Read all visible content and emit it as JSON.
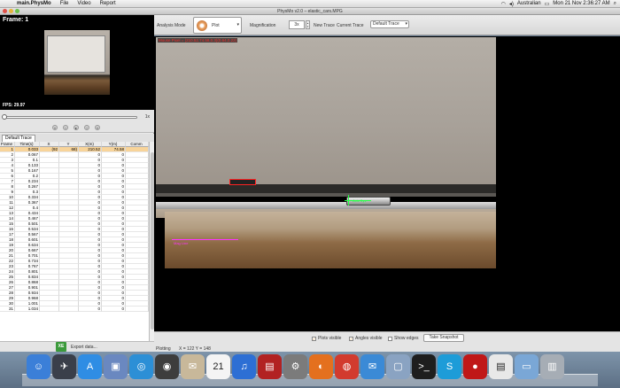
{
  "menubar": {
    "app": "main.PhysMo",
    "items": [
      "File",
      "Video",
      "Report"
    ],
    "status_icons": [
      "wifi",
      "volume",
      "battery"
    ],
    "language": "Australian",
    "clock": "Mon 21 Nov  2:36:27 AM"
  },
  "window": {
    "title": "PhysMo v2.0 – elastic_cars.MPG"
  },
  "preview": {
    "frame_label": "Frame: 1",
    "fps_label": "FPS: 29.97"
  },
  "playback": {
    "speed": "1x"
  },
  "trace_tab": "Default Trace",
  "table": {
    "columns": [
      "Frame",
      "Time(s)",
      "X",
      "Y",
      "X(m)",
      "Y(m)",
      "Comm"
    ],
    "rows": [
      [
        "1",
        "0.033",
        "(92",
        "68)",
        "210.52",
        "74.58",
        ""
      ],
      [
        "2",
        "0.067",
        "",
        "",
        "0",
        "0",
        ""
      ],
      [
        "3",
        "0.1",
        "",
        "",
        "0",
        "0",
        ""
      ],
      [
        "4",
        "0.133",
        "",
        "",
        "0",
        "0",
        ""
      ],
      [
        "5",
        "0.167",
        "",
        "",
        "0",
        "0",
        ""
      ],
      [
        "6",
        "0.2",
        "",
        "",
        "0",
        "0",
        ""
      ],
      [
        "7",
        "0.234",
        "",
        "",
        "0",
        "0",
        ""
      ],
      [
        "8",
        "0.267",
        "",
        "",
        "0",
        "0",
        ""
      ],
      [
        "9",
        "0.3",
        "",
        "",
        "0",
        "0",
        ""
      ],
      [
        "10",
        "0.334",
        "",
        "",
        "0",
        "0",
        ""
      ],
      [
        "11",
        "0.367",
        "",
        "",
        "0",
        "0",
        ""
      ],
      [
        "12",
        "0.4",
        "",
        "",
        "0",
        "0",
        ""
      ],
      [
        "13",
        "0.434",
        "",
        "",
        "0",
        "0",
        ""
      ],
      [
        "14",
        "0.467",
        "",
        "",
        "0",
        "0",
        ""
      ],
      [
        "15",
        "0.501",
        "",
        "",
        "0",
        "0",
        ""
      ],
      [
        "16",
        "0.534",
        "",
        "",
        "0",
        "0",
        ""
      ],
      [
        "17",
        "0.567",
        "",
        "",
        "0",
        "0",
        ""
      ],
      [
        "18",
        "0.601",
        "",
        "",
        "0",
        "0",
        ""
      ],
      [
        "19",
        "0.634",
        "",
        "",
        "0",
        "0",
        ""
      ],
      [
        "20",
        "0.667",
        "",
        "",
        "0",
        "0",
        ""
      ],
      [
        "21",
        "0.701",
        "",
        "",
        "0",
        "0",
        ""
      ],
      [
        "22",
        "0.734",
        "",
        "",
        "0",
        "0",
        ""
      ],
      [
        "23",
        "0.767",
        "",
        "",
        "0",
        "0",
        ""
      ],
      [
        "24",
        "0.801",
        "",
        "",
        "0",
        "0",
        ""
      ],
      [
        "25",
        "0.834",
        "",
        "",
        "0",
        "0",
        ""
      ],
      [
        "26",
        "0.868",
        "",
        "",
        "0",
        "0",
        ""
      ],
      [
        "27",
        "0.901",
        "",
        "",
        "0",
        "0",
        ""
      ],
      [
        "28",
        "0.934",
        "",
        "",
        "0",
        "0",
        ""
      ],
      [
        "29",
        "0.968",
        "",
        "",
        "0",
        "0",
        ""
      ],
      [
        "30",
        "1.001",
        "",
        "",
        "0",
        "0",
        ""
      ],
      [
        "31",
        "1.034",
        "",
        "",
        "0",
        "0",
        ""
      ]
    ]
  },
  "export_label": "Export data...",
  "toolbar": {
    "analysis_mode_label": "Analysis Mode",
    "analysis_mode_value": "Plot",
    "magnification_label": "Magnification",
    "magnification_value": "3x",
    "new_trace_label": "New Trace",
    "current_trace_label": "Current Trace",
    "current_trace_value": "Default Trace"
  },
  "video": {
    "status_overlay": "Mouse Pixel = (210.52,74.58,0.3)(0.64,0.22)",
    "axis_label": "Axis Sys",
    "magnification_line_label": "Mag Line"
  },
  "bottombar": {
    "plots_visible": "Plots visible",
    "angles_visible": "Angles visible",
    "show_edges": "Show edges",
    "take_snapshot": "Take Snapshot",
    "plotting": "Plotting",
    "coords": "X = 122   Y = 148"
  },
  "dock": {
    "icons": [
      "finder-icon",
      "launchpad-icon",
      "app-store-icon",
      "preview-icon",
      "safari-icon",
      "photo-booth-icon",
      "mail-icon",
      "calendar-icon",
      "itunes-icon",
      "photo-icon",
      "system-preferences-icon",
      "firefox-icon",
      "chrome-icon",
      "mail2-icon",
      "virtualbox-icon",
      "terminal-icon",
      "skype-icon",
      "apple-icon",
      "documents-icon",
      "finder-folder-icon",
      "trash-icon"
    ],
    "calendar_day": "21"
  },
  "colors": {
    "selection": "#f8d49a",
    "dock": "#6b7f94",
    "trace": "#ff2222",
    "axis": "#22ff44",
    "magline": "#ff33ff"
  }
}
